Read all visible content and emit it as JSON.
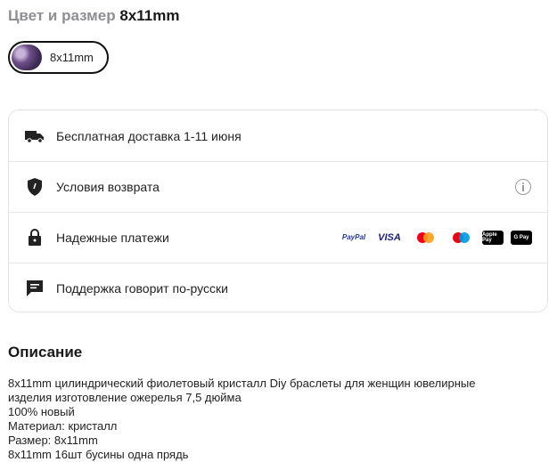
{
  "variant": {
    "label": "Цвет и размер",
    "value": "8x11mm",
    "chip_text": "8x11mm"
  },
  "features": {
    "delivery": "Бесплатная доставка 1-11 июня",
    "returns": "Условия возврата",
    "payments": "Надежные платежи",
    "support": "Поддержка говорит по-русски",
    "payment_methods": [
      "PayPal",
      "VISA",
      "mastercard",
      "maestro",
      "Apple Pay",
      "G Pay"
    ]
  },
  "description": {
    "title": "Описание",
    "lines": [
      "8x11mm цилиндрический фиолетовый кристалл Diy браслеты для женщин ювелирные",
      "изделия изготовление ожерелья 7,5 дюйма",
      "100% новый",
      "Материал: кристалл",
      "Размер: 8x11mm",
      "8x11mm 16шт бусины одна прядь"
    ]
  }
}
